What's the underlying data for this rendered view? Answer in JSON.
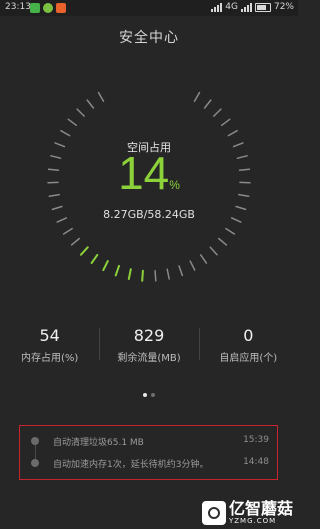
{
  "status_bar": {
    "time": "23:13",
    "network": "4G",
    "battery": "72%"
  },
  "page": {
    "title": "安全中心"
  },
  "gauge": {
    "label": "空间占用",
    "value": "14",
    "unit": "%",
    "detail": "8.27GB/58.24GB",
    "fraction": 0.14,
    "accent_color": "#8cd13a"
  },
  "stats": [
    {
      "value": "54",
      "label": "内存占用(%)"
    },
    {
      "value": "829",
      "label": "剩余流量(MB)"
    },
    {
      "value": "0",
      "label": "自启应用(个)"
    }
  ],
  "pager": {
    "count": 2,
    "active": 0
  },
  "log": [
    {
      "text": "自动清理垃圾65.1 MB",
      "time": "15:39"
    },
    {
      "text": "自动加速内存1次，延长待机约3分钟。",
      "time": "14:48"
    }
  ],
  "watermark": {
    "brand": "亿智蘑菇",
    "site": "YZMG.COM"
  },
  "colors": {
    "background": "#262626",
    "highlight_border": "#c5252d"
  }
}
